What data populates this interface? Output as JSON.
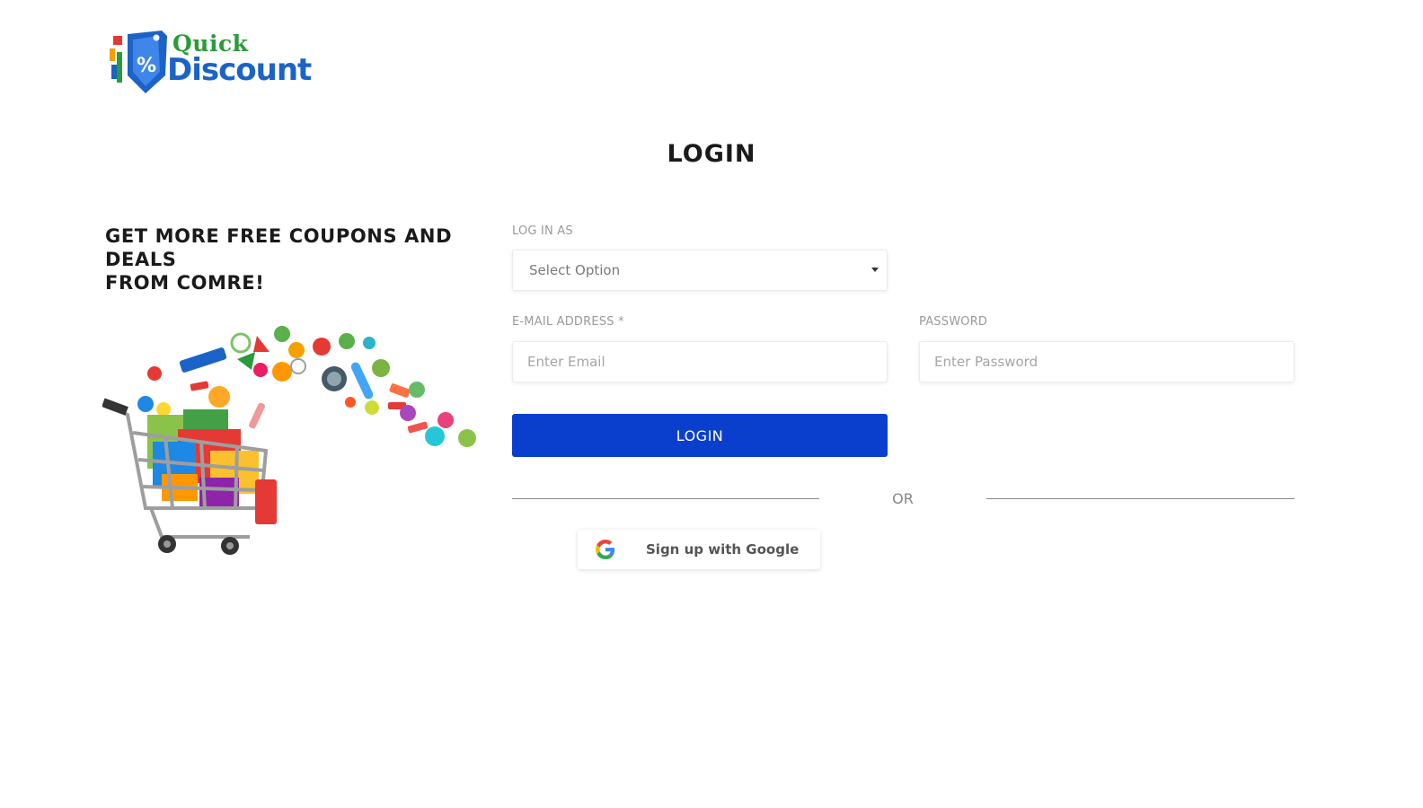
{
  "brand": {
    "line1": "Quick",
    "line2": "Discount"
  },
  "page": {
    "title": "LOGIN"
  },
  "promo": {
    "line1": "GET MORE FREE COUPONS AND DEALS",
    "line2": "FROM COMRE!"
  },
  "form": {
    "login_as_label": "LOG IN AS",
    "login_as_value": "Select Option",
    "email_label": "E-MAIL ADDRESS *",
    "email_placeholder": "Enter Email",
    "password_label": "PASSWORD",
    "password_placeholder": "Enter Password",
    "submit_label": "LOGIN",
    "divider_label": "OR",
    "google_label": "Sign up with Google"
  },
  "colors": {
    "primary": "#0a3fce",
    "brand_green": "#2a9b3a",
    "brand_blue": "#1b63c6"
  },
  "icons": {
    "logo": "price-tag-logo-icon",
    "select": "caret-down-icon",
    "google": "google-g-icon",
    "illustration": "shopping-cart-illustration"
  }
}
